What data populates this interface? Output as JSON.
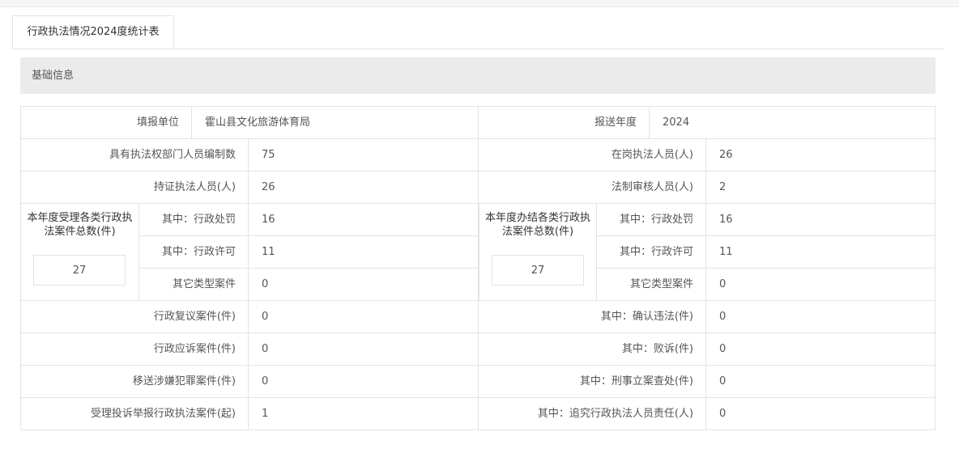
{
  "tab": {
    "label": "行政执法情况2024度统计表"
  },
  "section": {
    "title": "基础信息"
  },
  "form": {
    "unit_label": "填报单位",
    "unit_value": "霍山县文化旅游体育局",
    "year_label": "报送年度",
    "year_value": "2024",
    "staff_quota_label": "具有执法权部门人员编制数",
    "staff_quota_value": "75",
    "on_duty_label": "在岗执法人员(人)",
    "on_duty_value": "26",
    "certified_label": "持证执法人员(人)",
    "certified_value": "26",
    "legal_review_label": "法制审核人员(人)",
    "legal_review_value": "2",
    "accepted": {
      "title": "本年度受理各类行政执法案件总数(件)",
      "total": "27",
      "penalty_label": "其中：行政处罚",
      "penalty_value": "16",
      "permit_label": "其中：行政许可",
      "permit_value": "11",
      "other_label": "其它类型案件",
      "other_value": "0"
    },
    "concluded": {
      "title": "本年度办结各类行政执法案件总数(件)",
      "total": "27",
      "penalty_label": "其中：行政处罚",
      "penalty_value": "16",
      "permit_label": "其中：行政许可",
      "permit_value": "11",
      "other_label": "其它类型案件",
      "other_value": "0"
    },
    "review_label": "行政复议案件(件)",
    "review_value": "0",
    "confirm_illegal_label": "其中：确认违法(件)",
    "confirm_illegal_value": "0",
    "lawsuit_label": "行政应诉案件(件)",
    "lawsuit_value": "0",
    "lost_label": "其中：败诉(件)",
    "lost_value": "0",
    "crime_label": "移送涉嫌犯罪案件(件)",
    "crime_value": "0",
    "criminal_case_label": "其中：刑事立案查处(件)",
    "criminal_case_value": "0",
    "complaint_label": "受理投诉举报行政执法案件(起)",
    "complaint_value": "1",
    "accountability_label": "其中：追究行政执法人员责任(人)",
    "accountability_value": "0"
  }
}
